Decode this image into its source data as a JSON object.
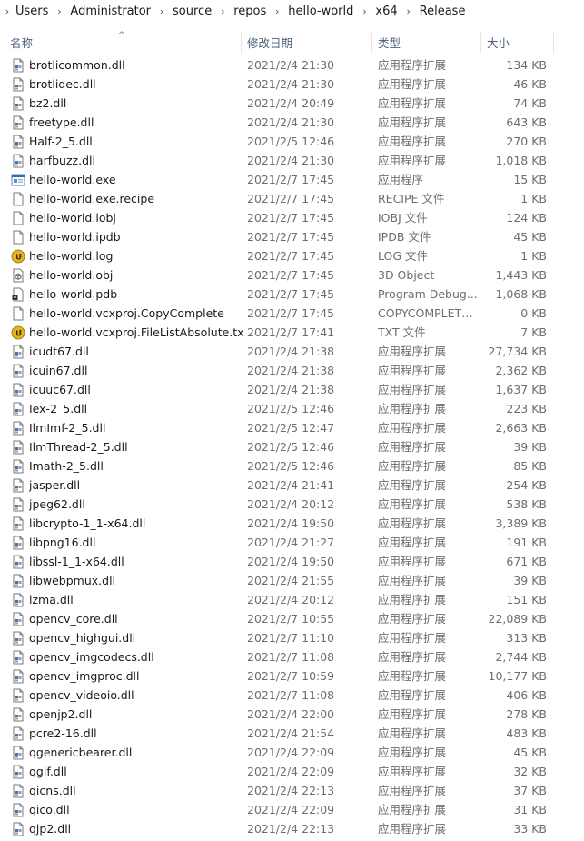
{
  "breadcrumb": [
    "Users",
    "Administrator",
    "source",
    "repos",
    "hello-world",
    "x64",
    "Release"
  ],
  "columns": {
    "name": "名称",
    "date": "修改日期",
    "type": "类型",
    "size": "大小"
  },
  "files": [
    {
      "name": "brotlicommon.dll",
      "date": "2021/2/4 21:30",
      "type": "应用程序扩展",
      "size": "134 KB",
      "icon": "dll-icon"
    },
    {
      "name": "brotlidec.dll",
      "date": "2021/2/4 21:30",
      "type": "应用程序扩展",
      "size": "46 KB",
      "icon": "dll-icon"
    },
    {
      "name": "bz2.dll",
      "date": "2021/2/4 20:49",
      "type": "应用程序扩展",
      "size": "74 KB",
      "icon": "dll-icon"
    },
    {
      "name": "freetype.dll",
      "date": "2021/2/4 21:30",
      "type": "应用程序扩展",
      "size": "643 KB",
      "icon": "dll-icon"
    },
    {
      "name": "Half-2_5.dll",
      "date": "2021/2/5 12:46",
      "type": "应用程序扩展",
      "size": "270 KB",
      "icon": "dll-icon"
    },
    {
      "name": "harfbuzz.dll",
      "date": "2021/2/4 21:30",
      "type": "应用程序扩展",
      "size": "1,018 KB",
      "icon": "dll-icon"
    },
    {
      "name": "hello-world.exe",
      "date": "2021/2/7 17:45",
      "type": "应用程序",
      "size": "15 KB",
      "icon": "exe-icon"
    },
    {
      "name": "hello-world.exe.recipe",
      "date": "2021/2/7 17:45",
      "type": "RECIPE 文件",
      "size": "1 KB",
      "icon": "file-icon"
    },
    {
      "name": "hello-world.iobj",
      "date": "2021/2/7 17:45",
      "type": "IOBJ 文件",
      "size": "124 KB",
      "icon": "file-icon"
    },
    {
      "name": "hello-world.ipdb",
      "date": "2021/2/7 17:45",
      "type": "IPDB 文件",
      "size": "45 KB",
      "icon": "file-icon"
    },
    {
      "name": "hello-world.log",
      "date": "2021/2/7 17:45",
      "type": "LOG 文件",
      "size": "1 KB",
      "icon": "log-icon"
    },
    {
      "name": "hello-world.obj",
      "date": "2021/2/7 17:45",
      "type": "3D Object",
      "size": "1,443 KB",
      "icon": "obj-icon"
    },
    {
      "name": "hello-world.pdb",
      "date": "2021/2/7 17:45",
      "type": "Program Debug...",
      "size": "1,068 KB",
      "icon": "pdb-icon"
    },
    {
      "name": "hello-world.vcxproj.CopyComplete",
      "date": "2021/2/7 17:45",
      "type": "COPYCOMPLETE...",
      "size": "0 KB",
      "icon": "file-icon"
    },
    {
      "name": "hello-world.vcxproj.FileListAbsolute.txt",
      "date": "2021/2/7 17:41",
      "type": "TXT 文件",
      "size": "7 KB",
      "icon": "log-icon"
    },
    {
      "name": "icudt67.dll",
      "date": "2021/2/4 21:38",
      "type": "应用程序扩展",
      "size": "27,734 KB",
      "icon": "dll-icon"
    },
    {
      "name": "icuin67.dll",
      "date": "2021/2/4 21:38",
      "type": "应用程序扩展",
      "size": "2,362 KB",
      "icon": "dll-icon"
    },
    {
      "name": "icuuc67.dll",
      "date": "2021/2/4 21:38",
      "type": "应用程序扩展",
      "size": "1,637 KB",
      "icon": "dll-icon"
    },
    {
      "name": "Iex-2_5.dll",
      "date": "2021/2/5 12:46",
      "type": "应用程序扩展",
      "size": "223 KB",
      "icon": "dll-icon"
    },
    {
      "name": "IlmImf-2_5.dll",
      "date": "2021/2/5 12:47",
      "type": "应用程序扩展",
      "size": "2,663 KB",
      "icon": "dll-icon"
    },
    {
      "name": "IlmThread-2_5.dll",
      "date": "2021/2/5 12:46",
      "type": "应用程序扩展",
      "size": "39 KB",
      "icon": "dll-icon"
    },
    {
      "name": "Imath-2_5.dll",
      "date": "2021/2/5 12:46",
      "type": "应用程序扩展",
      "size": "85 KB",
      "icon": "dll-icon"
    },
    {
      "name": "jasper.dll",
      "date": "2021/2/4 21:41",
      "type": "应用程序扩展",
      "size": "254 KB",
      "icon": "dll-icon"
    },
    {
      "name": "jpeg62.dll",
      "date": "2021/2/4 20:12",
      "type": "应用程序扩展",
      "size": "538 KB",
      "icon": "dll-icon"
    },
    {
      "name": "libcrypto-1_1-x64.dll",
      "date": "2021/2/4 19:50",
      "type": "应用程序扩展",
      "size": "3,389 KB",
      "icon": "dll-icon"
    },
    {
      "name": "libpng16.dll",
      "date": "2021/2/4 21:27",
      "type": "应用程序扩展",
      "size": "191 KB",
      "icon": "dll-icon"
    },
    {
      "name": "libssl-1_1-x64.dll",
      "date": "2021/2/4 19:50",
      "type": "应用程序扩展",
      "size": "671 KB",
      "icon": "dll-icon"
    },
    {
      "name": "libwebpmux.dll",
      "date": "2021/2/4 21:55",
      "type": "应用程序扩展",
      "size": "39 KB",
      "icon": "dll-icon"
    },
    {
      "name": "lzma.dll",
      "date": "2021/2/4 20:12",
      "type": "应用程序扩展",
      "size": "151 KB",
      "icon": "dll-icon"
    },
    {
      "name": "opencv_core.dll",
      "date": "2021/2/7 10:55",
      "type": "应用程序扩展",
      "size": "22,089 KB",
      "icon": "dll-icon"
    },
    {
      "name": "opencv_highgui.dll",
      "date": "2021/2/7 11:10",
      "type": "应用程序扩展",
      "size": "313 KB",
      "icon": "dll-icon"
    },
    {
      "name": "opencv_imgcodecs.dll",
      "date": "2021/2/7 11:08",
      "type": "应用程序扩展",
      "size": "2,744 KB",
      "icon": "dll-icon"
    },
    {
      "name": "opencv_imgproc.dll",
      "date": "2021/2/7 10:59",
      "type": "应用程序扩展",
      "size": "10,177 KB",
      "icon": "dll-icon"
    },
    {
      "name": "opencv_videoio.dll",
      "date": "2021/2/7 11:08",
      "type": "应用程序扩展",
      "size": "406 KB",
      "icon": "dll-icon"
    },
    {
      "name": "openjp2.dll",
      "date": "2021/2/4 22:00",
      "type": "应用程序扩展",
      "size": "278 KB",
      "icon": "dll-icon"
    },
    {
      "name": "pcre2-16.dll",
      "date": "2021/2/4 21:54",
      "type": "应用程序扩展",
      "size": "483 KB",
      "icon": "dll-icon"
    },
    {
      "name": "qgenericbearer.dll",
      "date": "2021/2/4 22:09",
      "type": "应用程序扩展",
      "size": "45 KB",
      "icon": "dll-icon"
    },
    {
      "name": "qgif.dll",
      "date": "2021/2/4 22:09",
      "type": "应用程序扩展",
      "size": "32 KB",
      "icon": "dll-icon"
    },
    {
      "name": "qicns.dll",
      "date": "2021/2/4 22:13",
      "type": "应用程序扩展",
      "size": "37 KB",
      "icon": "dll-icon"
    },
    {
      "name": "qico.dll",
      "date": "2021/2/4 22:09",
      "type": "应用程序扩展",
      "size": "31 KB",
      "icon": "dll-icon"
    },
    {
      "name": "qjp2.dll",
      "date": "2021/2/4 22:13",
      "type": "应用程序扩展",
      "size": "33 KB",
      "icon": "dll-icon"
    }
  ]
}
